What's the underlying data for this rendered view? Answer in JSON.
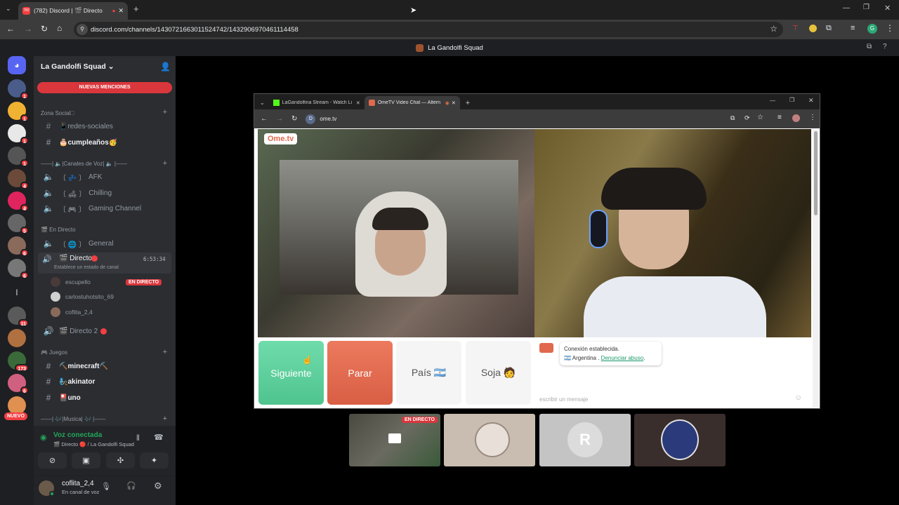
{
  "browser": {
    "tab_title": "(782) Discord | 🎬 Directo",
    "tab_badge": "782",
    "url": "discord.com/channels/1430721663011524742/1432906970461114458",
    "stream_title": "La Gandolfi Squad",
    "profile_letter": "G"
  },
  "server": {
    "name": "La Gandolfi Squad",
    "mentions_banner": "NUEVAS MENCIONES",
    "categories": {
      "social": "Zona Social🗆",
      "voice": "——| 🔈|Canales de Voz| 🔈 |——",
      "live": "🎬 En Directo",
      "games": "🎮 Juegos",
      "music": "——| 🎶|Musica| 🎶 |——"
    },
    "channels": {
      "redes": "📱redes-sociales",
      "cumple": "🎂cumpleaños🥳",
      "afk": "AFK",
      "afk_prefix": "〔 💤 〕",
      "chilling": "Chilling",
      "chilling_prefix": "〔 🛋 〕",
      "gaming": "Gaming Channel",
      "gaming_prefix": "〔 🎮 〕",
      "general": "General",
      "general_prefix": "〔 🌐 〕",
      "directo": "🎬 Directo",
      "directo_time": "6:53:34",
      "directo_status": "Establece un estado de canal",
      "directo2": "🎬 Directo 2",
      "minecraft": "⛏️minecraft⛏️",
      "akinator": "🧞akinator",
      "uno": "🎴uno"
    },
    "voice_users": [
      {
        "name": "escupello",
        "live": "EN DIRECTO"
      },
      {
        "name": "carlostuhotsito_69"
      },
      {
        "name": "coflita_2,4"
      }
    ],
    "guild_badges": [
      "1",
      "1",
      "1",
      "1",
      "4",
      "4",
      "4",
      "5",
      "6",
      "6",
      "11",
      "173",
      "6"
    ],
    "guild_letter": "l",
    "new_label": "NUEVO"
  },
  "voice_panel": {
    "status": "Voz conectada",
    "location": "🎬 Directo 🔴 / La Gandolfi Squad"
  },
  "user_panel": {
    "username": "coflita_2,4",
    "substatus": "En canal de voz"
  },
  "inner_browser": {
    "tab1": "LaGandolfina Stream - Watch Li",
    "tab2": "OmeTV Video Chat — Altern",
    "url": "ome.tv"
  },
  "ometv": {
    "logo": "Ome.tv",
    "buttons": {
      "next": "Siguiente",
      "stop": "Parar",
      "country": "País 🇦🇷",
      "gender": "Soja 🧑"
    },
    "chat": {
      "connected": "Conexión establecida.",
      "country": "Argentina",
      "report": "Denunciar abuso",
      "placeholder": "escribir un mensaje"
    }
  },
  "thumbnails": {
    "live_badge": "EN DIRECTO"
  },
  "colors": {
    "discord_red": "#f23f43",
    "discord_green": "#23a55a",
    "ome_green": "#5dd39e",
    "ome_red": "#e0694e"
  }
}
